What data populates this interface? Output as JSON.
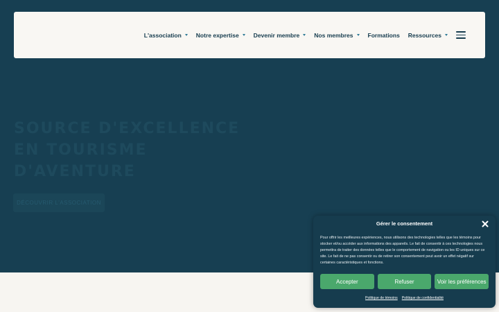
{
  "nav": {
    "items": [
      {
        "label": "L'association",
        "has_dropdown": true
      },
      {
        "label": "Notre expertise",
        "has_dropdown": true
      },
      {
        "label": "Devenir membre",
        "has_dropdown": true
      },
      {
        "label": "Nos membres",
        "has_dropdown": true
      },
      {
        "label": "Formations",
        "has_dropdown": false
      },
      {
        "label": "Ressources",
        "has_dropdown": true
      }
    ],
    "menu_icon": "hamburger-icon"
  },
  "hero": {
    "title_line1": "SOURCE D'EXCELLENCE",
    "title_line2": "EN TOURISME",
    "title_line3": "D'AVENTURE",
    "cta_label": "DÉCOUVRIR L'ASSOCIATION"
  },
  "consent": {
    "title": "Gérer le consentement",
    "close_icon": "close-icon",
    "text": "Pour offrir les meilleures expériences, nous utilisons des technologies telles que les témoins pour stocker et/ou accéder aux informations des appareils. Le fait de consentir à ces technologies nous permettra de traiter des données telles que le comportement de navigation ou les ID uniques sur ce site. Le fait de ne pas consentir ou de retirer son consentement peut avoir un effet négatif sur certaines caractéristiques et fonctions.",
    "accept_label": "Accepter",
    "refuse_label": "Refuser",
    "prefs_label": "Voir les préférences",
    "link_cookies": "Politique de témoins",
    "link_privacy": "Politique de confidentialité"
  },
  "colors": {
    "hero_bg": "#173f52",
    "nav_bg": "#f9f7f3",
    "nav_text": "#163c4e",
    "caret": "#2e7a96",
    "button_green": "#4aa86c",
    "consent_bg": "#163c4e",
    "bottom_band": "#f7f5f1"
  }
}
